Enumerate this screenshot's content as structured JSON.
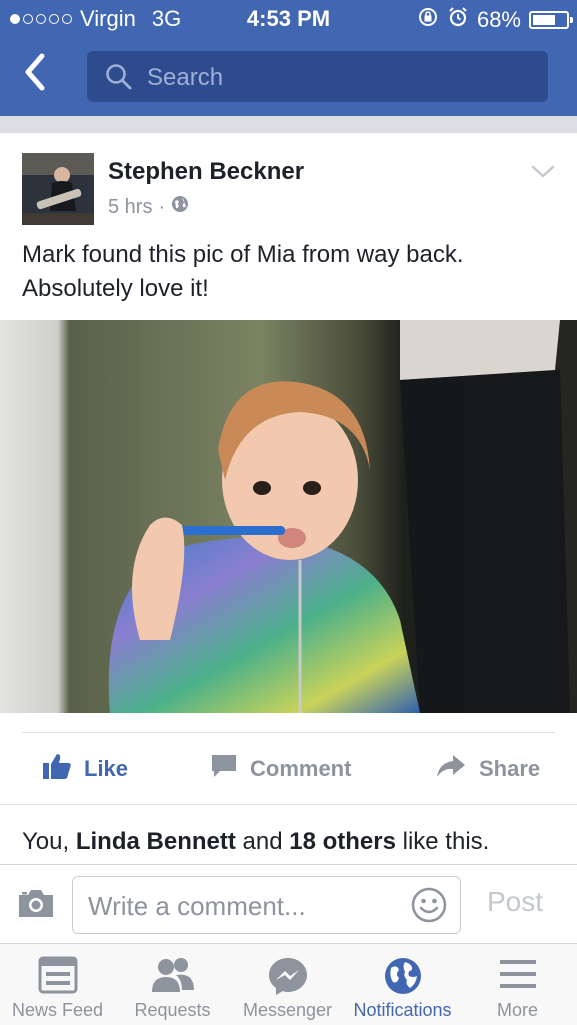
{
  "status_bar": {
    "carrier": "Virgin",
    "network": "3G",
    "time": "4:53 PM",
    "battery": "68%",
    "battery_level": 0.68,
    "signal_bars": 1
  },
  "nav": {
    "search_placeholder": "Search"
  },
  "post": {
    "author": "Stephen Beckner",
    "time_ago": "5 hrs",
    "separator": "·",
    "text": "Mark found this pic of Mia from way back. Absolutely love it!",
    "actions": {
      "like": "Like",
      "comment": "Comment",
      "share": "Share"
    },
    "likes": {
      "prefix": "You, ",
      "name": "Linda Bennett",
      "middle": " and ",
      "others": "18 others",
      "suffix": " like this."
    }
  },
  "composer": {
    "placeholder": "Write a comment...",
    "post_label": "Post"
  },
  "tabs": [
    {
      "label": "News Feed",
      "icon": "news-feed-icon"
    },
    {
      "label": "Requests",
      "icon": "requests-icon"
    },
    {
      "label": "Messenger",
      "icon": "messenger-icon"
    },
    {
      "label": "Notifications",
      "icon": "globe-icon"
    },
    {
      "label": "More",
      "icon": "menu-icon"
    }
  ],
  "colors": {
    "brand": "#4267b2",
    "muted": "#8d949e"
  }
}
